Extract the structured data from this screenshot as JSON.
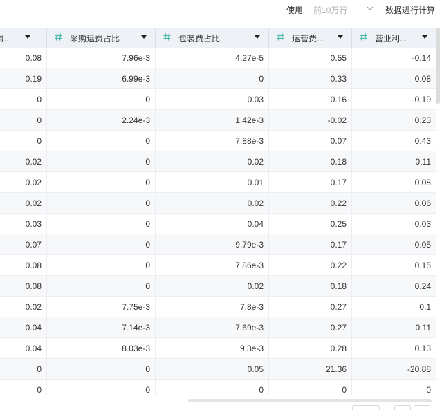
{
  "toolbar": {
    "use_label": "使用",
    "sample_value": "前10万行",
    "calc_label": "数据进行计算"
  },
  "columns": [
    {
      "title": "广费..."
    },
    {
      "title": "采购运费占比"
    },
    {
      "title": "包装费占比"
    },
    {
      "title": "运营费..."
    },
    {
      "title": "营业利..."
    }
  ],
  "rows": [
    [
      "0.08",
      "7.96e-3",
      "4.27e-5",
      "0.55",
      "-0.14"
    ],
    [
      "0.19",
      "6.99e-3",
      "0",
      "0.33",
      "0.08"
    ],
    [
      "0",
      "0",
      "0.03",
      "0.16",
      "0.19"
    ],
    [
      "0",
      "2.24e-3",
      "1.42e-3",
      "-0.02",
      "0.23"
    ],
    [
      "0",
      "0",
      "7.88e-3",
      "0.07",
      "0.43"
    ],
    [
      "0.02",
      "0",
      "0.02",
      "0.18",
      "0.11"
    ],
    [
      "0.02",
      "0",
      "0.01",
      "0.17",
      "0.08"
    ],
    [
      "0.02",
      "0",
      "0.02",
      "0.22",
      "0.06"
    ],
    [
      "0.03",
      "0",
      "0.04",
      "0.25",
      "0.03"
    ],
    [
      "0.07",
      "0",
      "9.79e-3",
      "0.17",
      "0.05"
    ],
    [
      "0.08",
      "0",
      "7.86e-3",
      "0.22",
      "0.15"
    ],
    [
      "0.08",
      "0",
      "0.02",
      "0.18",
      "0.24"
    ],
    [
      "0.02",
      "7.75e-3",
      "7.8e-3",
      "0.27",
      "0.1"
    ],
    [
      "0.04",
      "7.14e-3",
      "7.69e-3",
      "0.27",
      "0.11"
    ],
    [
      "0.04",
      "8.03e-3",
      "9.3e-3",
      "0.28",
      "0.13"
    ],
    [
      "0",
      "0",
      "0.05",
      "21.36",
      "-20.88"
    ],
    [
      "0",
      "0",
      "0",
      "0",
      "0"
    ]
  ],
  "colors": {
    "header_bg": "#eef1f6",
    "hash_icon": "#4bb8a9",
    "alt_row": "#f7f8fa"
  },
  "icons": {
    "column_type": "number-hash-icon",
    "sort": "caret-down-icon",
    "select": "chevron-down-icon"
  }
}
